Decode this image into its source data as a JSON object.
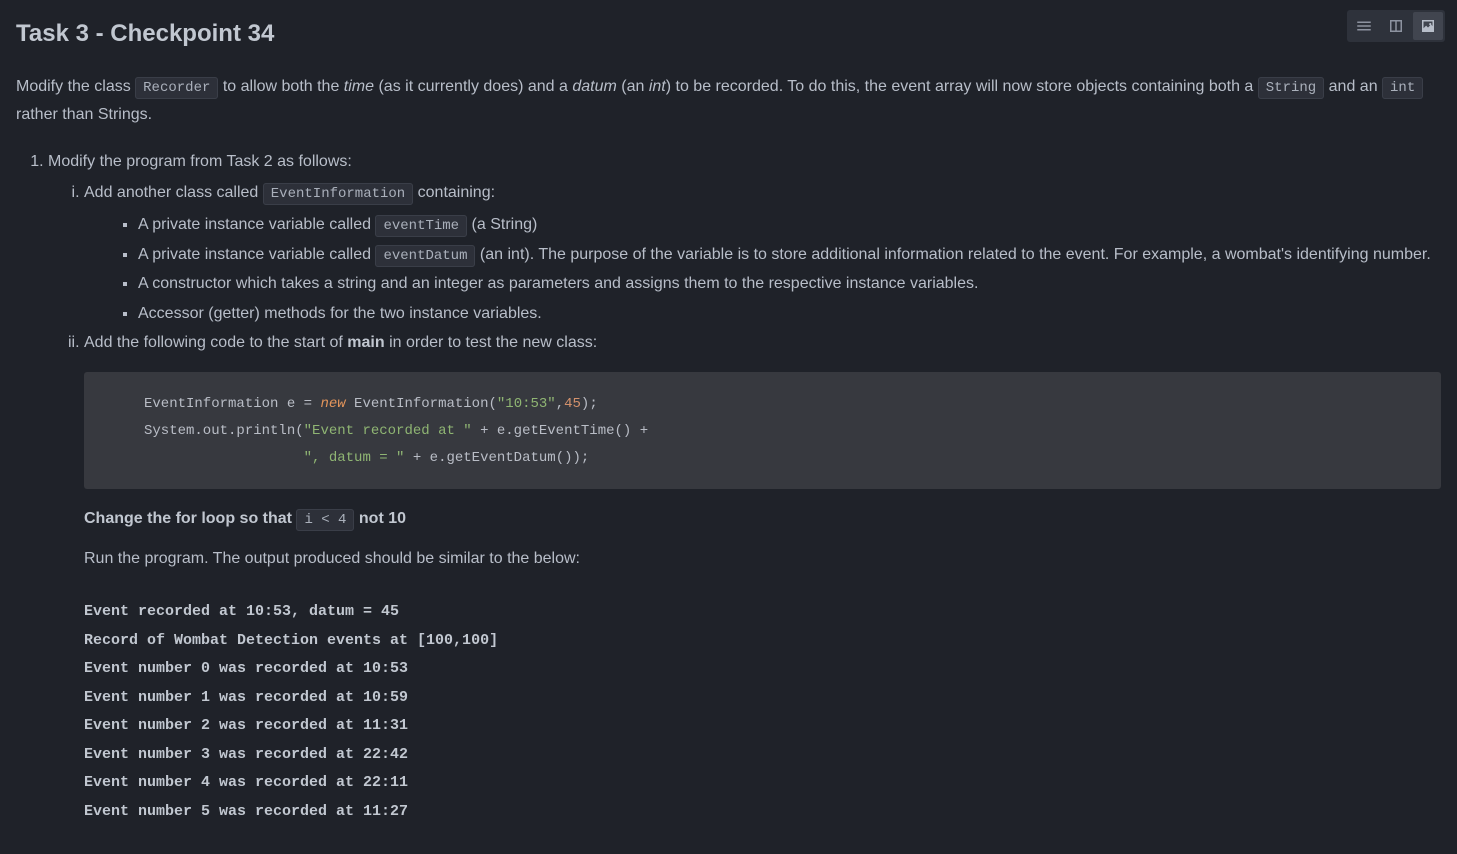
{
  "title": "Task 3 - Checkpoint 34",
  "toolbar": {
    "icons": [
      "menu-icon",
      "sidebar-icon",
      "image-icon"
    ]
  },
  "intro": {
    "p1a": "Modify the class ",
    "code1": "Recorder",
    "p1b": " to allow both the ",
    "it1": "time",
    "p1c": " (as it currently does) and a ",
    "it2": "datum",
    "p1d": " (an ",
    "it3": "int",
    "p1e": ") to be recorded. To do this, the event array will now store objects containing both a ",
    "code2": "String",
    "p1f": " and an ",
    "code3": "int",
    "p1g": " rather than Strings."
  },
  "step1_label": "Modify the program from Task 2 as follows:",
  "step1i": {
    "a": "Add another class called ",
    "code": "EventInformation",
    "b": " containing:"
  },
  "bullets_i": {
    "b1a": "A private instance variable called ",
    "b1c": "eventTime",
    "b1b": " (a String)",
    "b2a": "A private instance variable called ",
    "b2c": "eventDatum",
    "b2b": " (an int). The purpose of the variable is to store additional information related to the event. For example, a wombat's identifying number.",
    "b3": "A constructor which takes a string and an integer as parameters and assigns them to the respective instance variables.",
    "b4": "Accessor (getter) methods for the two instance variables."
  },
  "step1ii": {
    "a": "Add the following code to the start of ",
    "bold": "main",
    "b": " in order to test the new class:"
  },
  "code_block": {
    "l1a": "EventInformation e = ",
    "l1kw": "new",
    "l1b": " EventInformation(",
    "l1s": "\"10:53\"",
    "l1c": ",",
    "l1n": "45",
    "l1d": ");",
    "l2a": "System.out.println(",
    "l2s": "\"Event recorded at \"",
    "l2b": " + e.getEventTime() +",
    "l3pad": "                   ",
    "l3s": "\", datum = \"",
    "l3b": " + e.getEventDatum());"
  },
  "change_loop": {
    "a": "Change the for loop so that ",
    "code": "i < 4",
    "b": " not 10"
  },
  "run_text": "Run the program. The output produced should be similar to the below:",
  "output_lines": "Event recorded at 10:53, datum = 45\nRecord of Wombat Detection events at [100,100]\nEvent number 0 was recorded at 10:53\nEvent number 1 was recorded at 10:59\nEvent number 2 was recorded at 11:31\nEvent number 3 was recorded at 22:42\nEvent number 4 was recorded at 22:11\nEvent number 5 was recorded at 11:27"
}
